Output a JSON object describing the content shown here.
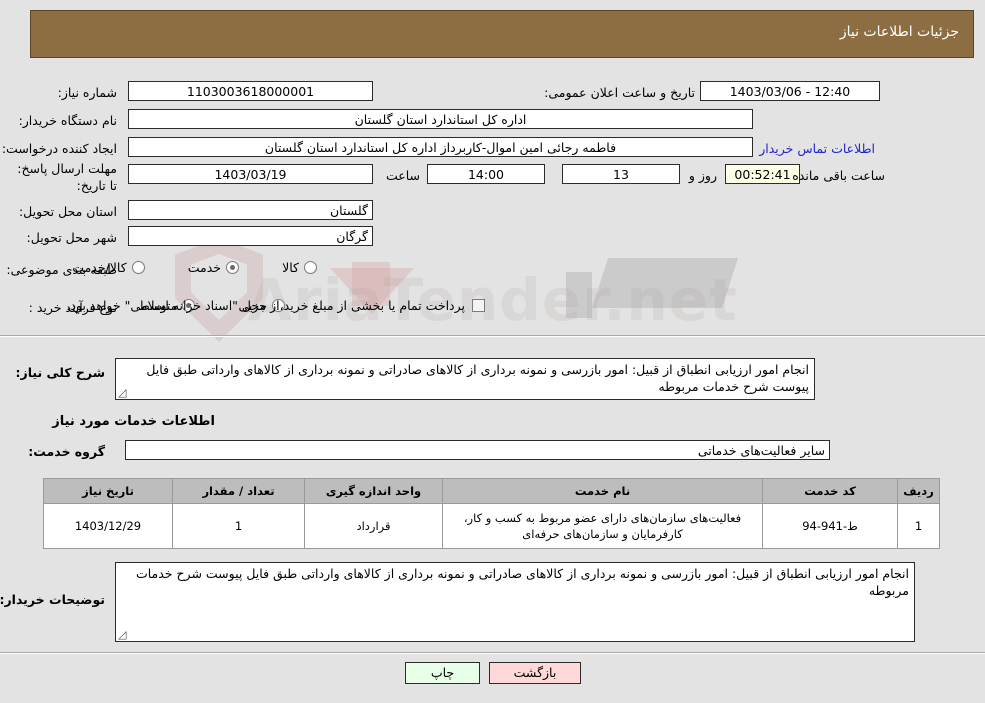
{
  "header": {
    "title": "جزئیات اطلاعات نیاز"
  },
  "watermark": {
    "text": "AriaTender.net"
  },
  "form": {
    "need_number_label": "شماره نیاز:",
    "need_number_value": "1103003618000001",
    "announce_label": "تاریخ و ساعت اعلان عمومی:",
    "announce_value": "12:40 - 1403/03/06",
    "buyer_org_label": "نام دستگاه خریدار:",
    "buyer_org_value": "اداره کل استاندارد استان گلستان",
    "creator_label": "ایجاد کننده درخواست:",
    "creator_value": "فاطمه رجائی امین اموال-کاربرداز اداره کل استاندارد استان گلستان",
    "contact_link": "اطلاعات تماس خریدار",
    "deadline_label": "مهلت ارسال پاسخ: تا تاریخ:",
    "deadline_date": "1403/03/19",
    "hour_label": "ساعت",
    "deadline_time": "14:00",
    "days_value": "13",
    "days_unit": "روز و",
    "countdown_value": "00:52:41",
    "countdown_suffix": "ساعت باقی مانده",
    "province_label": "استان محل تحویل:",
    "province_value": "گلستان",
    "city_label": "شهر محل تحویل:",
    "city_value": "گرگان",
    "category_label": "طبقه بندی موضوعی:",
    "category_options": [
      {
        "label": "کالا",
        "checked": false
      },
      {
        "label": "خدمت",
        "checked": true
      },
      {
        "label": "کالا/خدمت",
        "checked": false
      }
    ],
    "process_label": "نوع فرآیند خرید :",
    "process_options": [
      {
        "label": "جزیی",
        "checked": false
      },
      {
        "label": "متوسط",
        "checked": true
      }
    ],
    "treasury_checkbox_checked": false,
    "treasury_text": "پرداخت تمام یا بخشی از مبلغ خرید،از محل \"اسناد خزانه اسلامی\" خواهد بود.",
    "general_desc_label": "شرح کلی نیاز:",
    "general_desc_value": "انجام امور ارزیابی انطباق از قبیل: امور بازرسی و نمونه برداری از کالاهای صادراتی و نمونه برداری از کالاهای وارداتی طبق فایل پیوست شرح خدمات مربوطه",
    "services_section_title": "اطلاعات خدمات مورد نیاز",
    "service_group_label": "گروه خدمت:",
    "service_group_value": "سایر فعالیت‌های خدماتی",
    "buyer_notes_label": "توضیحات خریدار:",
    "buyer_notes_value": "انجام امور ارزیابی انطباق از قبیل: امور بازرسی و نمونه برداری از کالاهای صادراتی و نمونه برداری از کالاهای وارداتی طبق فایل پیوست شرح خدمات مربوطه"
  },
  "table": {
    "columns": [
      "ردیف",
      "کد خدمت",
      "نام خدمت",
      "واحد اندازه گیری",
      "تعداد / مقدار",
      "تاریخ نیاز"
    ],
    "rows": [
      {
        "row": "1",
        "code": "ط-941-94",
        "name": "فعالیت‌های سازمان‌های دارای عضو مربوط به کسب و کار، کارفرمایان و سازمان‌های حرفه‌ای",
        "unit": "قرارداد",
        "qty": "1",
        "date": "1403/12/29"
      }
    ]
  },
  "buttons": {
    "print": "چاپ",
    "back": "بازگشت"
  },
  "colors": {
    "header_bg": "#8d6e43",
    "page_bg": "#e3e3e3",
    "link": "#2222cc",
    "countdown_bg": "#fffee6",
    "print_bg": "#e8ffe8",
    "back_bg": "#ffd9d9",
    "table_header_bg": "#bdbdbd"
  }
}
